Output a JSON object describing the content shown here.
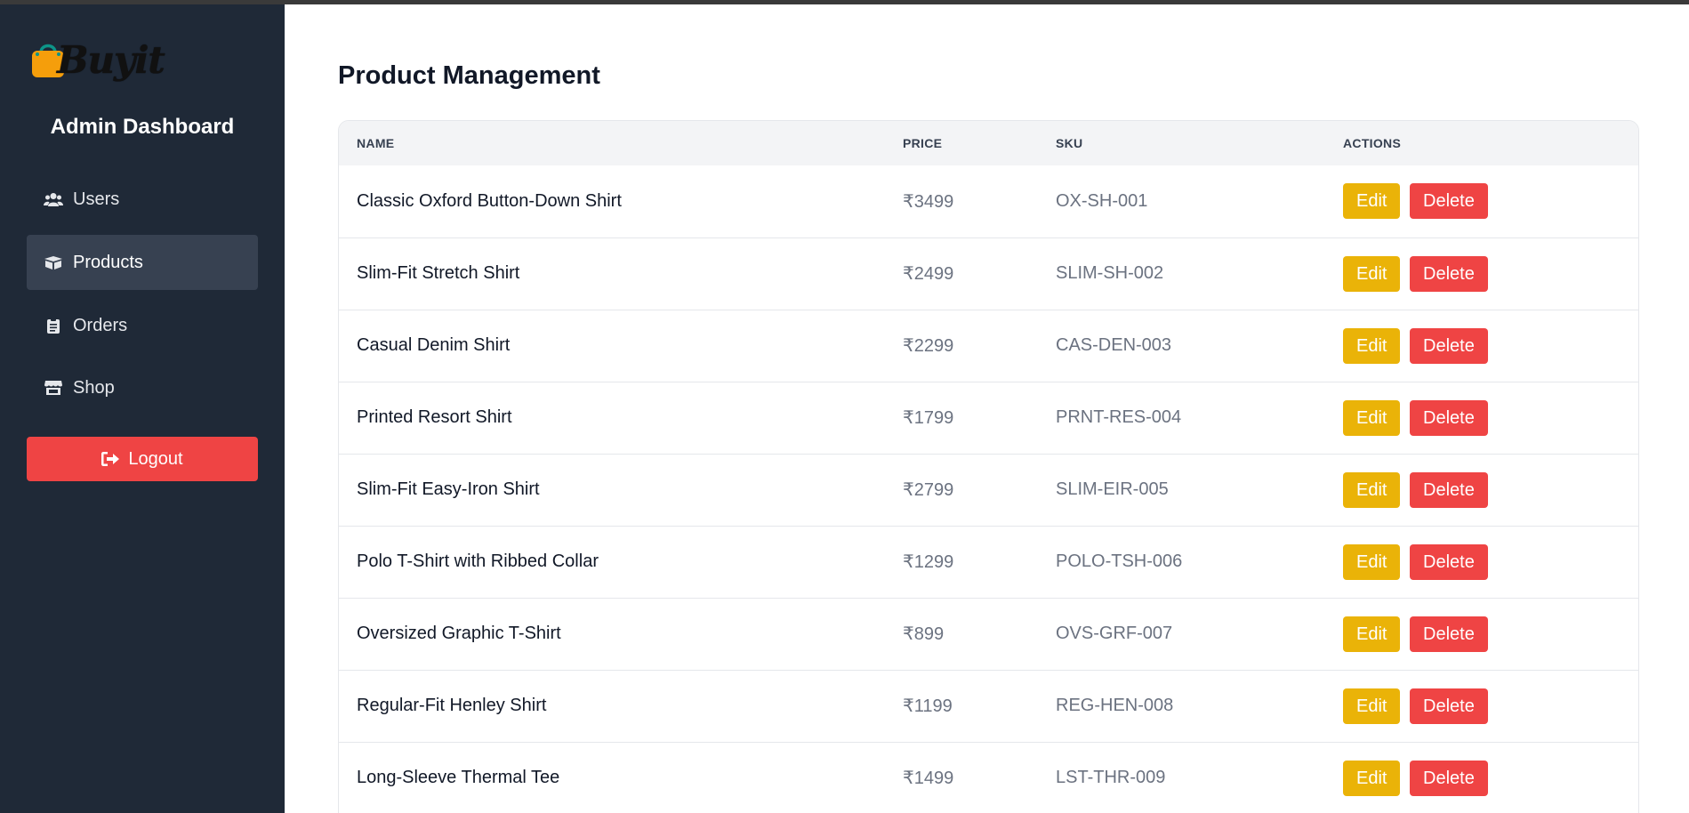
{
  "brand": {
    "name": "Buyit",
    "bag_color": "#f59e0b",
    "handle_color": "#0d9488"
  },
  "sidebar": {
    "title": "Admin Dashboard",
    "items": [
      {
        "label": "Users",
        "icon": "users-icon",
        "active": false
      },
      {
        "label": "Products",
        "icon": "box-icon",
        "active": true
      },
      {
        "label": "Orders",
        "icon": "clipboard-icon",
        "active": false
      },
      {
        "label": "Shop",
        "icon": "store-icon",
        "active": false
      }
    ],
    "logout_label": "Logout"
  },
  "main": {
    "title": "Product Management",
    "table": {
      "headers": [
        "NAME",
        "PRICE",
        "SKU",
        "ACTIONS"
      ],
      "rows": [
        {
          "name": "Classic Oxford Button-Down Shirt",
          "price": "₹3499",
          "sku": "OX-SH-001"
        },
        {
          "name": "Slim-Fit Stretch Shirt",
          "price": "₹2499",
          "sku": "SLIM-SH-002"
        },
        {
          "name": "Casual Denim Shirt",
          "price": "₹2299",
          "sku": "CAS-DEN-003"
        },
        {
          "name": "Printed Resort Shirt",
          "price": "₹1799",
          "sku": "PRNT-RES-004"
        },
        {
          "name": "Slim-Fit Easy-Iron Shirt",
          "price": "₹2799",
          "sku": "SLIM-EIR-005"
        },
        {
          "name": "Polo T-Shirt with Ribbed Collar",
          "price": "₹1299",
          "sku": "POLO-TSH-006"
        },
        {
          "name": "Oversized Graphic T-Shirt",
          "price": "₹899",
          "sku": "OVS-GRF-007"
        },
        {
          "name": "Regular-Fit Henley Shirt",
          "price": "₹1199",
          "sku": "REG-HEN-008"
        },
        {
          "name": "Long-Sleeve Thermal Tee",
          "price": "₹1499",
          "sku": "LST-THR-009"
        }
      ],
      "edit_label": "Edit",
      "delete_label": "Delete"
    }
  },
  "colors": {
    "sidebar_bg": "#1f2937",
    "active_item_bg": "#374151",
    "danger": "#ef4444",
    "warning": "#eab308",
    "header_bg": "#f3f4f6"
  }
}
